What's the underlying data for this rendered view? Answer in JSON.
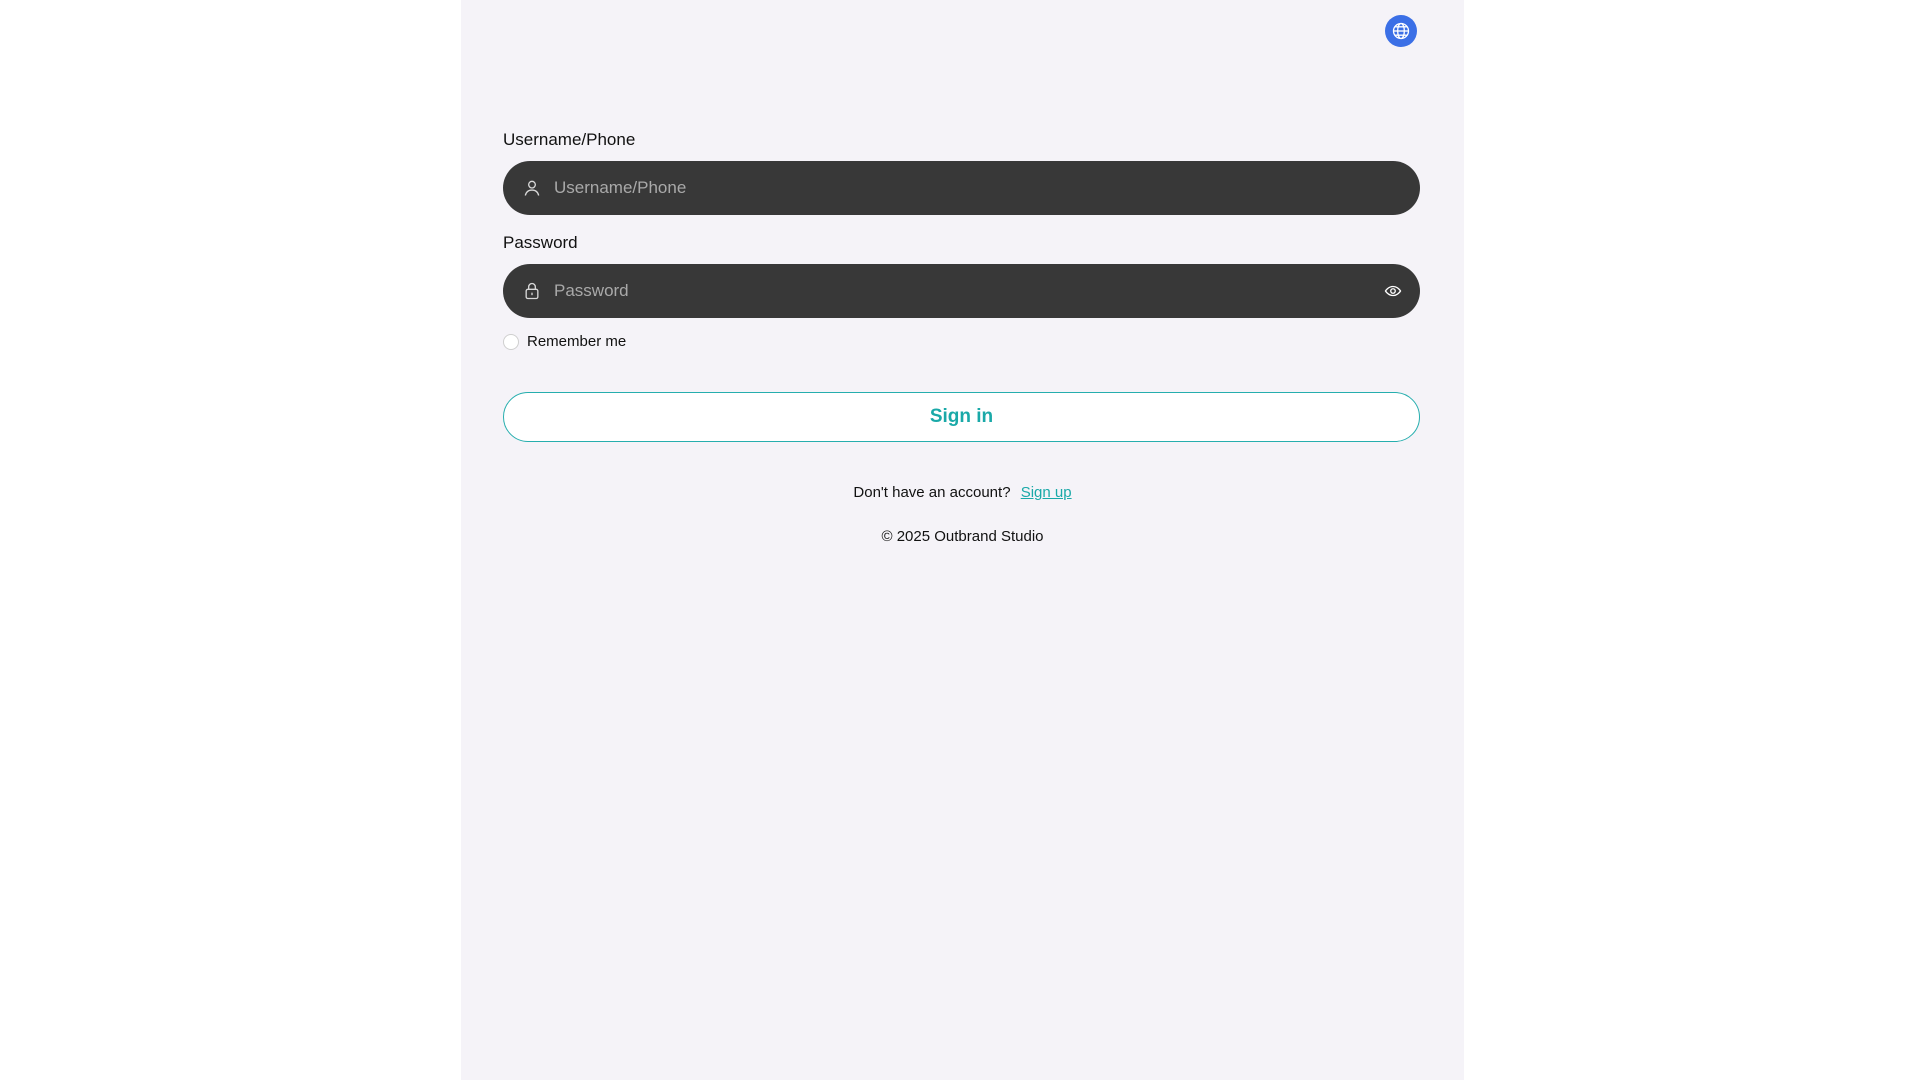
{
  "header": {
    "language_icon": "globe-icon",
    "accent_color": "#3b6fe6"
  },
  "form": {
    "username": {
      "label": "Username/Phone",
      "placeholder": "Username/Phone",
      "icon": "user-icon"
    },
    "password": {
      "label": "Password",
      "placeholder": "Password",
      "icon": "lock-icon",
      "toggle_icon": "eye-icon"
    },
    "remember_label": "Remember me",
    "submit_label": "Sign in",
    "submit_color": "#1aa9a8"
  },
  "signup": {
    "prompt": "Don't have an account?",
    "link_label": "Sign up"
  },
  "footer": {
    "copyright": "© 2025 Outbrand Studio"
  }
}
